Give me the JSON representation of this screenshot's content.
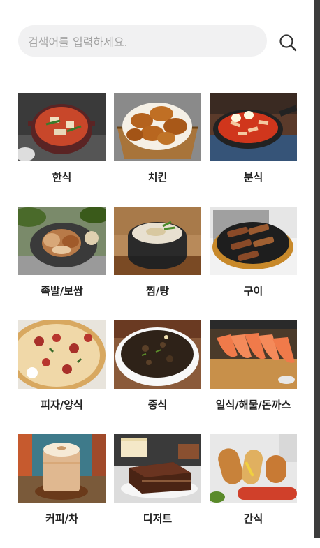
{
  "search": {
    "placeholder": "검색어를 입력하세요."
  },
  "categories": [
    {
      "label": "한식"
    },
    {
      "label": "치킨"
    },
    {
      "label": "분식"
    },
    {
      "label": "족발/보쌈"
    },
    {
      "label": "찜/탕"
    },
    {
      "label": "구이"
    },
    {
      "label": "피자/양식"
    },
    {
      "label": "중식"
    },
    {
      "label": "일식/해물/돈까스"
    },
    {
      "label": "커피/차"
    },
    {
      "label": "디저트"
    },
    {
      "label": "간식"
    }
  ],
  "colors": {
    "search_bg": "#f1f1f2",
    "placeholder": "#a3a3a3",
    "label": "#222222"
  }
}
